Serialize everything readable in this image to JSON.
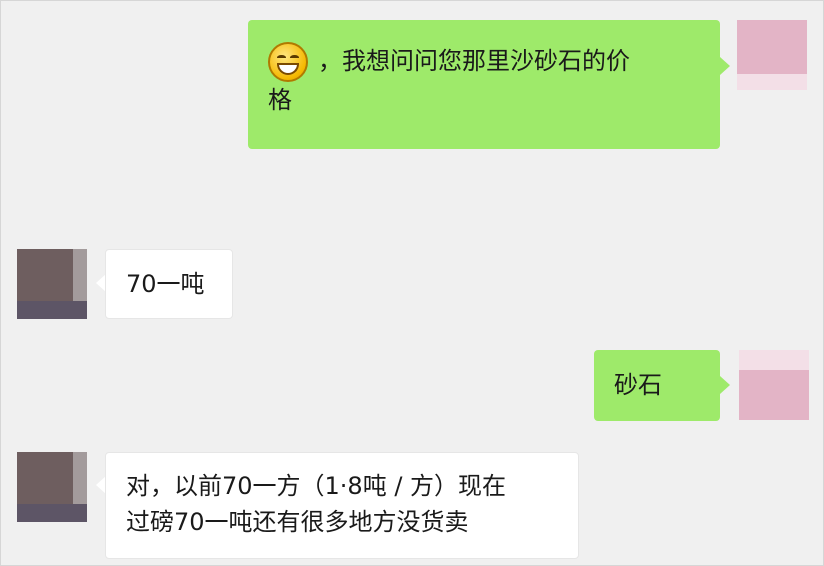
{
  "messages": [
    {
      "from": "self",
      "emoji": "grinning-face-emoji",
      "text_line1": "，我想问问您那里沙砂石的价",
      "text_line2": "格"
    },
    {
      "from": "other",
      "text": "70一吨"
    },
    {
      "from": "self",
      "text": "砂石"
    },
    {
      "from": "other",
      "text_line1": "对，以前70一方（1·8吨 / 方）现在",
      "text_line2": "过磅70一吨还有很多地方没货卖"
    }
  ],
  "colors": {
    "outgoing_bubble": "#9eea6a",
    "incoming_bubble": "#ffffff",
    "background": "#f0f0f0"
  }
}
